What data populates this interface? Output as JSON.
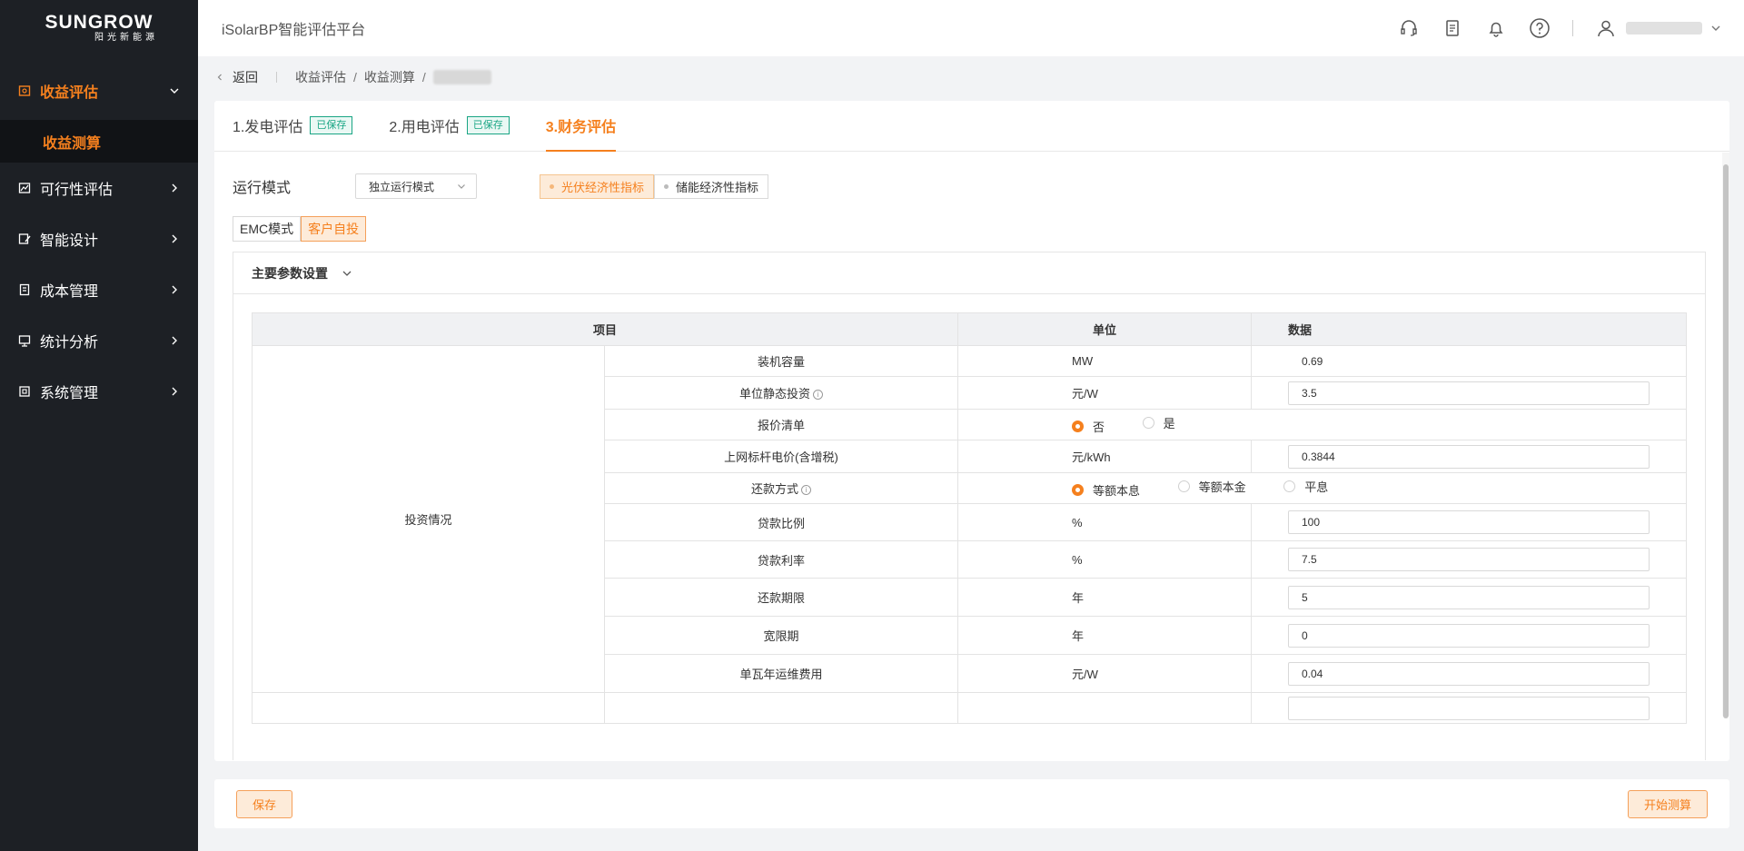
{
  "brand": {
    "name": "SUNGROW",
    "sub": "阳光新能源"
  },
  "app": {
    "title": "iSolarBP智能评估平台"
  },
  "sidebar": {
    "items": [
      {
        "label": "收益评估",
        "icon": "revenue-icon"
      },
      {
        "label": "收益测算"
      },
      {
        "label": "可行性评估",
        "icon": "chart-icon"
      },
      {
        "label": "智能设计",
        "icon": "design-icon"
      },
      {
        "label": "成本管理",
        "icon": "cost-icon"
      },
      {
        "label": "统计分析",
        "icon": "stats-icon"
      },
      {
        "label": "系统管理",
        "icon": "system-icon"
      }
    ]
  },
  "breadcrumb": {
    "back": "返回",
    "l1": "收益评估",
    "l2": "收益测算",
    "sep": "/"
  },
  "tabs": [
    {
      "label": "1.发电评估",
      "badge": "已保存"
    },
    {
      "label": "2.用电评估",
      "badge": "已保存"
    },
    {
      "label": "3.财务评估"
    }
  ],
  "mode": {
    "label": "运行模式",
    "value": "独立运行模式"
  },
  "indicator": {
    "opt1": "光伏经济性指标",
    "opt2": "储能经济性指标",
    "selected": "光伏经济性指标"
  },
  "invest": {
    "opt1": "EMC模式",
    "opt2": "客户自投",
    "selected": "客户自投"
  },
  "panel": {
    "title": "主要参数设置"
  },
  "table": {
    "headers": {
      "item": "项目",
      "unit": "单位",
      "data": "数据"
    },
    "group": "投资情况",
    "rows": [
      {
        "name": "装机容量",
        "unit": "MW",
        "value": "0.69"
      },
      {
        "name": "单位静态投资",
        "unit": "元/W",
        "value": "3.5"
      },
      {
        "name": "报价清单",
        "options": [
          "否",
          "是"
        ],
        "selected": "否"
      },
      {
        "name": "上网标杆电价(含增税)",
        "unit": "元/kWh",
        "value": "0.3844"
      },
      {
        "name": "还款方式",
        "options": [
          "等额本息",
          "等额本金",
          "平息"
        ],
        "selected": "等额本息"
      },
      {
        "name": "贷款比例",
        "unit": "%",
        "value": "100"
      },
      {
        "name": "贷款利率",
        "unit": "%",
        "value": "7.5"
      },
      {
        "name": "还款期限",
        "unit": "年",
        "value": "5"
      },
      {
        "name": "宽限期",
        "unit": "年",
        "value": "0"
      },
      {
        "name": "单瓦年运维费用",
        "unit": "元/W",
        "value": "0.04"
      }
    ]
  },
  "footer": {
    "save": "保存",
    "start": "开始测算"
  },
  "colors": {
    "accent": "#f5801e",
    "sidebar": "#1d2025",
    "saved_badge": "#19a584"
  }
}
